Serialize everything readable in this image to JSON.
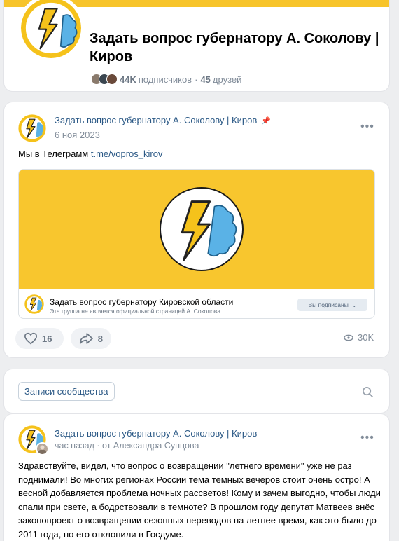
{
  "header": {
    "title": "Задать вопрос губернатору А. Соколову | Киров",
    "subscribers_count": "44K",
    "subscribers_label": "подписчиков",
    "separator": "·",
    "friends_count": "45",
    "friends_label": "друзей",
    "accent_color": "#f7c42a"
  },
  "pinned_post": {
    "author": "Задать вопрос губернатору А. Соколову | Киров",
    "date": "6 ноя 2023",
    "text_prefix": "Мы в Телеграмм",
    "link": "t.me/vopros_kirov",
    "snippet": {
      "title": "Задать вопрос губернатору Кировской области",
      "subtitle": "Эта группа не является официальной страницей А. Соколова",
      "button": "Вы подписаны"
    },
    "likes": "16",
    "shares": "8",
    "views": "30K"
  },
  "wall": {
    "tab_label": "Записи сообщества"
  },
  "post2": {
    "author": "Задать вопрос губернатору А. Соколову | Киров",
    "time": "час назад",
    "from": "· от Александра Сунцова",
    "text": "Здравствуйте, видел, что вопрос о возвращении \"летнего времени\" уже не раз поднимали! Во многих регионах России тема темных вечеров стоит очень остро! А весной добавляется проблема ночных рассветов! Кому и зачем выгодно, чтобы люди спали при свете, а бодрствовали в темноте? В прошлом году депутат Матвеев внёс законопроект о возвращении сезонных переводов на летнее время, как это было до 2011 года, но его отклонили в Госдуме."
  }
}
